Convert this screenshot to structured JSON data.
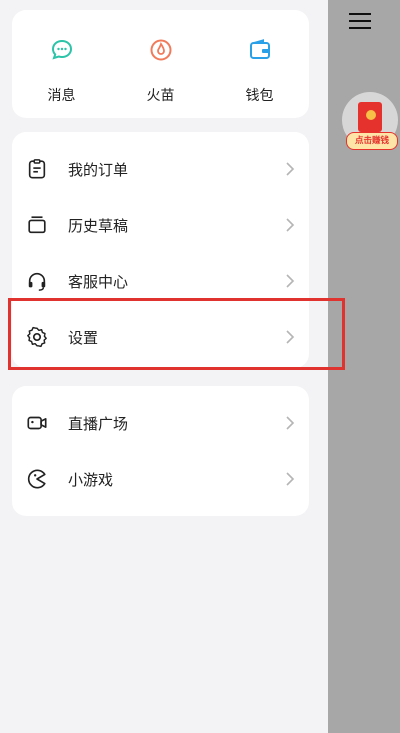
{
  "quick_actions": [
    {
      "label": "消息",
      "icon": "message-icon",
      "color": "#2bc4a8"
    },
    {
      "label": "火苗",
      "icon": "flame-icon",
      "color": "#f07a5a"
    },
    {
      "label": "钱包",
      "icon": "wallet-icon",
      "color": "#2aa0e8"
    }
  ],
  "menu_group_1": [
    {
      "label": "我的订单",
      "icon": "order-icon"
    },
    {
      "label": "历史草稿",
      "icon": "draft-icon"
    },
    {
      "label": "客服中心",
      "icon": "headset-icon"
    },
    {
      "label": "设置",
      "icon": "gear-icon"
    }
  ],
  "menu_group_2": [
    {
      "label": "直播广场",
      "icon": "live-camera-icon"
    },
    {
      "label": "小游戏",
      "icon": "game-icon"
    }
  ],
  "promo": {
    "tag": "点击赚钱"
  },
  "colors": {
    "highlight": "#e0322f",
    "overlay": "#a7a7a7"
  }
}
